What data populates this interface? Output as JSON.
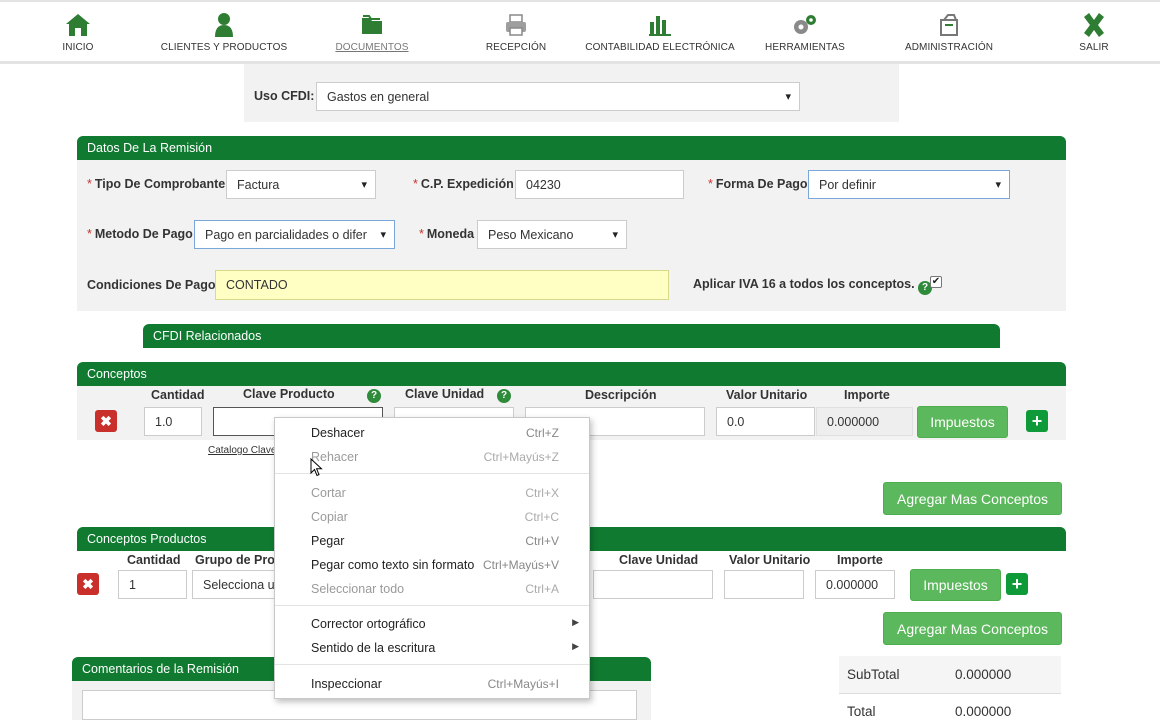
{
  "nav": [
    {
      "label": "INICIO",
      "icon": "home-icon"
    },
    {
      "label": "CLIENTES Y PRODUCTOS",
      "icon": "user-icon"
    },
    {
      "label": "DOCUMENTOS",
      "icon": "folder-icon"
    },
    {
      "label": "RECEPCIÓN",
      "icon": "printer-icon"
    },
    {
      "label": "CONTABILIDAD ELECTRÓNICA",
      "icon": "bar-chart-icon"
    },
    {
      "label": "HERRAMIENTAS",
      "icon": "gears-icon"
    },
    {
      "label": "ADMINISTRACIÓN",
      "icon": "box-icon"
    },
    {
      "label": "SALIR",
      "icon": "close-icon"
    }
  ],
  "uso_cfdi": {
    "label": "Uso CFDI:",
    "value": "Gastos en general"
  },
  "remision": {
    "title": "Datos De La Remisión",
    "tipo_label": "Tipo De Comprobante",
    "tipo_value": "Factura",
    "cp_label": "C.P. Expedición",
    "cp_value": "04230",
    "forma_label": "Forma De Pago",
    "forma_value": "Por definir",
    "metodo_label": "Metodo De Pago",
    "metodo_value": "Pago en parcialidades o difer",
    "moneda_label": "Moneda",
    "moneda_value": "Peso Mexicano",
    "condiciones_label": "Condiciones De Pago",
    "condiciones_value": "CONTADO",
    "iva_label": "Aplicar IVA 16 a todos los conceptos.",
    "required_mark": "*",
    "help_glyph": "?",
    "iva_checked": true
  },
  "cfdi_relacionados": {
    "title": "CFDI Relacionados"
  },
  "conceptos": {
    "title": "Conceptos",
    "headers": {
      "cantidad": "Cantidad",
      "clave_producto": "Clave Producto",
      "clave_unidad": "Clave Unidad",
      "descripcion": "Descripción",
      "valor_unitario": "Valor Unitario",
      "importe": "Importe"
    },
    "row": {
      "cantidad": "1.0",
      "clave_producto": "",
      "clave_unidad": "",
      "descripcion": "",
      "valor_unitario": "0.0",
      "importe": "0.000000"
    },
    "catalogo_link": "Catalogo Claves",
    "impuestos_button": "Impuestos",
    "agregar_button": "Agregar Mas Conceptos"
  },
  "conceptos_productos": {
    "title": "Conceptos Productos",
    "headers": {
      "cantidad": "Cantidad",
      "grupo": "Grupo de Pro",
      "clave_unidad": "Clave Unidad",
      "valor_unitario": "Valor Unitario",
      "importe": "Importe"
    },
    "row": {
      "cantidad": "1",
      "grupo": "Selecciona u",
      "clave_unidad": "",
      "valor_unitario": "",
      "importe": "0.000000"
    },
    "impuestos_button": "Impuestos",
    "agregar_button": "Agregar Mas Conceptos"
  },
  "comentarios": {
    "title": "Comentarios de la Remisión"
  },
  "totals": {
    "subtotal_label": "SubTotal",
    "subtotal_value": "0.000000",
    "total_label": "Total",
    "total_value": "0.000000"
  },
  "context_menu": {
    "items": [
      {
        "label": "Deshacer",
        "shortcut": "Ctrl+Z",
        "enabled": true
      },
      {
        "label": "Rehacer",
        "shortcut": "Ctrl+Mayús+Z",
        "enabled": false
      },
      {
        "label": "Cortar",
        "shortcut": "Ctrl+X",
        "enabled": false
      },
      {
        "label": "Copiar",
        "shortcut": "Ctrl+C",
        "enabled": false
      },
      {
        "label": "Pegar",
        "shortcut": "Ctrl+V",
        "enabled": true
      },
      {
        "label": "Pegar como texto sin formato",
        "shortcut": "Ctrl+Mayús+V",
        "enabled": true
      },
      {
        "label": "Seleccionar todo",
        "shortcut": "Ctrl+A",
        "enabled": false
      },
      {
        "label": "Corrector ortográfico",
        "shortcut": "",
        "enabled": true,
        "submenu": true
      },
      {
        "label": "Sentido de la escritura",
        "shortcut": "",
        "enabled": true,
        "submenu": true
      },
      {
        "label": "Inspeccionar",
        "shortcut": "Ctrl+Mayús+I",
        "enabled": true
      }
    ]
  },
  "colors": {
    "header_green": "#0f7a30",
    "button_green": "#5cb85c",
    "delete_red": "#c9302c",
    "panel_gray": "#f2f2f2",
    "highlight_yellow": "#ffffc4"
  }
}
